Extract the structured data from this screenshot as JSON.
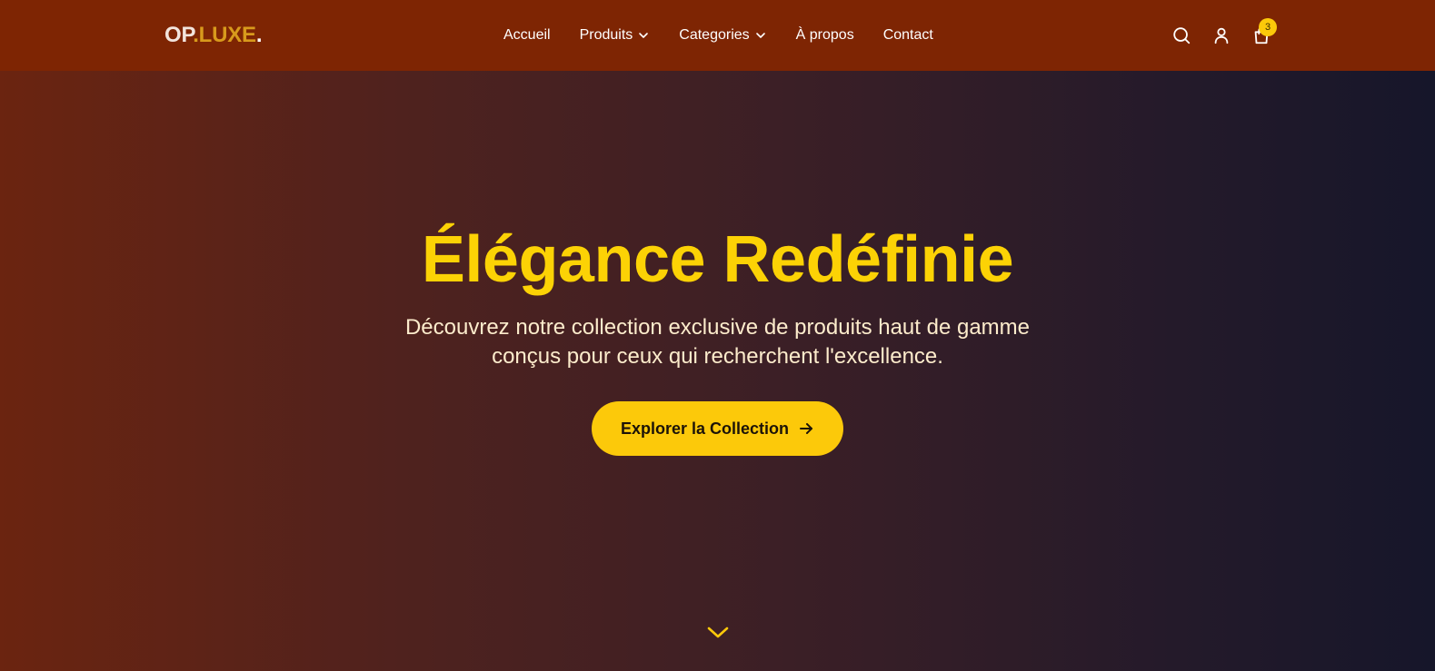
{
  "brand": {
    "part1": "OP",
    "part2": ".LUXE",
    "part3": "."
  },
  "nav": {
    "items": [
      {
        "label": "Accueil"
      },
      {
        "label": "Produits"
      },
      {
        "label": "Categories"
      },
      {
        "label": "À propos"
      },
      {
        "label": "Contact"
      }
    ]
  },
  "header_icons": {
    "search": "search-icon",
    "account": "user-icon",
    "cart": "shopping-bag-icon",
    "cart_count": "3"
  },
  "hero": {
    "title": "Élégance Redéfinie",
    "subtitle_line1": "Découvrez notre collection exclusive de produits haut de gamme",
    "subtitle_line2": "conçus pour ceux qui recherchent l'excellence.",
    "cta_label": "Explorer la Collection",
    "cta_icon": "arrow-right-icon",
    "scroll_icon": "chevron-down-icon"
  },
  "colors": {
    "header_bg": "#7e2503",
    "accent": "#fcc90a",
    "title": "#fcd205",
    "logo_accent": "#d89a1c",
    "subtitle": "#fdeccc"
  }
}
